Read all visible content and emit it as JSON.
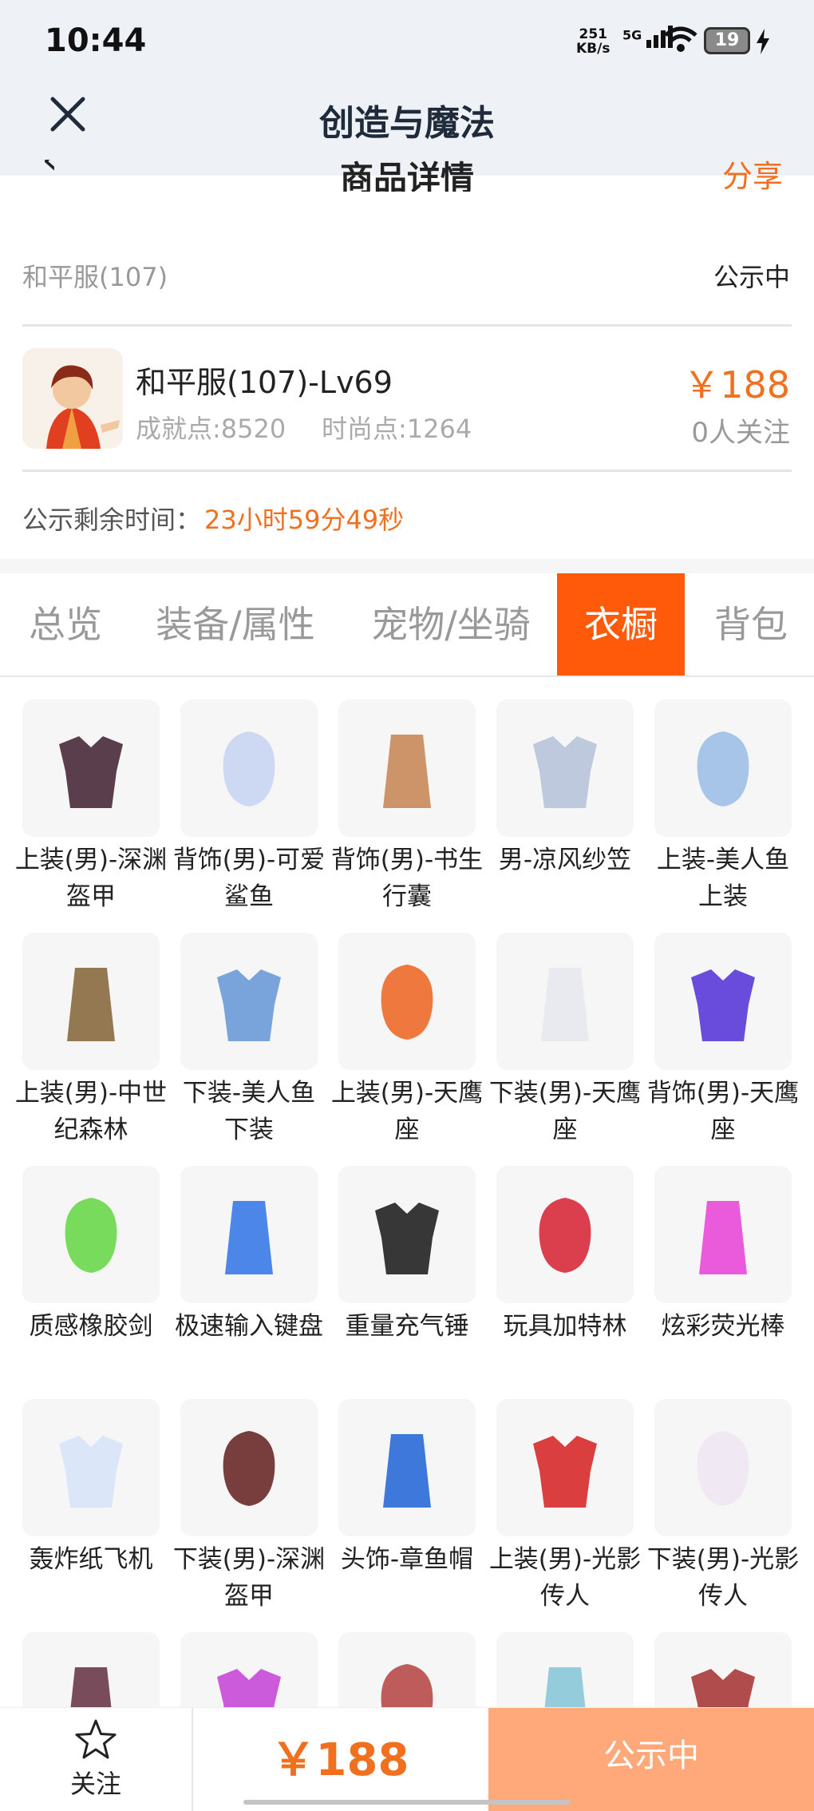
{
  "status_bar": {
    "time": "10:44",
    "net_speed": "251",
    "net_unit": "KB/s",
    "network": "5G",
    "battery": "19"
  },
  "title_bar": {
    "title": "创造与魔法"
  },
  "behind_header": {
    "title": "商品详情",
    "share": "分享"
  },
  "listing": {
    "server": "和平服(107)",
    "status": "公示中",
    "role_name": "和平服(107)-Lv69",
    "achievement": "成就点:8520",
    "fashion": "时尚点:1264",
    "price": "￥188",
    "followers": "0人关注",
    "remaining_label": "公示剩余时间：",
    "remaining_value": "23小时59分49秒"
  },
  "tabs": [
    "总览",
    "装备/属性",
    "宠物/坐骑",
    "衣橱",
    "背包"
  ],
  "active_tab": "衣橱",
  "items": [
    {
      "name": "上装(男)-深渊盔甲",
      "icon": "armor-icon",
      "color": "#4a2a3a"
    },
    {
      "name": "背饰(男)-可爱鲨鱼",
      "icon": "shark-backpack-icon",
      "color": "#c9d6f2"
    },
    {
      "name": "背饰(男)-书生行囊",
      "icon": "scholar-pack-icon",
      "color": "#c98a5a"
    },
    {
      "name": "男-凉风纱笠",
      "icon": "veil-hat-icon",
      "color": "#b8c4dc"
    },
    {
      "name": "上装-美人鱼上装",
      "icon": "mermaid-top-icon",
      "color": "#9ec0e8"
    },
    {
      "name": "上装(男)-中世纪森林",
      "icon": "forest-top-icon",
      "color": "#8a6a40"
    },
    {
      "name": "下装-美人鱼下装",
      "icon": "mermaid-bottom-icon",
      "color": "#6a9ad8"
    },
    {
      "name": "上装(男)-天鹰座",
      "icon": "aquila-top-icon",
      "color": "#ee6a2a"
    },
    {
      "name": "下装(男)-天鹰座",
      "icon": "aquila-bottom-icon",
      "color": "#e8e8f0"
    },
    {
      "name": "背饰(男)-天鹰座",
      "icon": "aquila-back-icon",
      "color": "#5a3ad8"
    },
    {
      "name": "质感橡胶剑",
      "icon": "rubber-sword-icon",
      "color": "#6ad84a"
    },
    {
      "name": "极速输入键盘",
      "icon": "keyboard-icon",
      "color": "#3a7ae8"
    },
    {
      "name": "重量充气锤",
      "icon": "hammer-icon",
      "color": "#222222"
    },
    {
      "name": "玩具加特林",
      "icon": "gatling-icon",
      "color": "#d82a3a"
    },
    {
      "name": "炫彩荧光棒",
      "icon": "glowstick-icon",
      "color": "#e84ad8"
    },
    {
      "name": "轰炸纸飞机",
      "icon": "paper-plane-icon",
      "color": "#d8e4f8"
    },
    {
      "name": "下装(男)-深渊盔甲",
      "icon": "abyss-pants-icon",
      "color": "#6a2a2a"
    },
    {
      "name": "头饰-章鱼帽",
      "icon": "octopus-hat-icon",
      "color": "#2a6ad8"
    },
    {
      "name": "上装(男)-光影传人",
      "icon": "red-jacket-icon",
      "color": "#d82a2a"
    },
    {
      "name": "下装(男)-光影传人",
      "icon": "white-boots-icon",
      "color": "#f0e8f4"
    },
    {
      "name": "",
      "icon": "helmet-icon",
      "color": "#6a3a4a"
    },
    {
      "name": "",
      "icon": "monster-bag-icon",
      "color": "#c84ad8"
    },
    {
      "name": "",
      "icon": "red-cape-icon",
      "color": "#b84a4a"
    },
    {
      "name": "",
      "icon": "astronaut-helmet-icon",
      "color": "#8ac8d8"
    },
    {
      "name": "",
      "icon": "red-boots-icon",
      "color": "#a83a3a"
    }
  ],
  "bottom_bar": {
    "follow": "关注",
    "price": "￥188",
    "status": "公示中"
  }
}
